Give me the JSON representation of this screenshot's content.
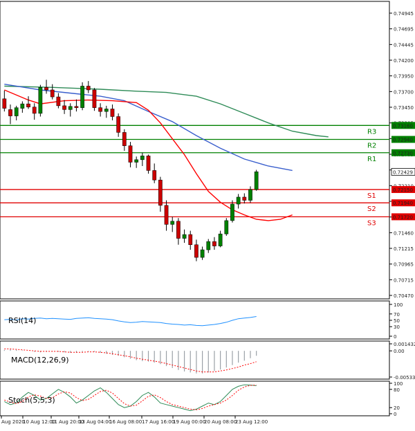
{
  "chart_data": [
    {
      "type": "candlestick",
      "panel": "price",
      "ylim": [
        0.7047,
        0.7505
      ],
      "y_ticks": [
        "0.74945",
        "0.74695",
        "0.74445",
        "0.74200",
        "0.73950",
        "0.73700",
        "0.73450",
        "0.73205",
        "0.72955",
        "0.72705",
        "0.72425",
        "0.72210",
        "0.71960",
        "0.71710",
        "0.71460",
        "0.71215",
        "0.70965",
        "0.70715",
        "0.70470"
      ],
      "x_ticks": [
        "Aug 2020",
        "10 Aug 12:00",
        "11 Aug 20:00",
        "13 Aug 04:00",
        "16 Aug 08:00",
        "17 Aug 16:00",
        "19 Aug 00:00",
        "20 Aug 08:00",
        "23 Aug 12:00"
      ],
      "last_price": {
        "value": 0.72429,
        "label": "0.72429",
        "color": "#000000"
      },
      "series": [
        {
          "kind": "sma",
          "color": "#2e8b57",
          "points": [
            [
              0,
              0.7378
            ],
            [
              8,
              0.7376
            ],
            [
              16,
              0.7373
            ],
            [
              22,
              0.737
            ],
            [
              27,
              0.7368
            ],
            [
              32,
              0.7362
            ],
            [
              36,
              0.735
            ],
            [
              40,
              0.7335
            ],
            [
              44,
              0.732
            ],
            [
              48,
              0.7307
            ],
            [
              52,
              0.73
            ],
            [
              54,
              0.7298
            ]
          ]
        },
        {
          "kind": "sma",
          "color": "#3a5fcd",
          "points": [
            [
              0,
              0.7381
            ],
            [
              6,
              0.7372
            ],
            [
              12,
              0.7366
            ],
            [
              16,
              0.7362
            ],
            [
              20,
              0.7355
            ],
            [
              24,
              0.7338
            ],
            [
              28,
              0.7322
            ],
            [
              32,
              0.73
            ],
            [
              36,
              0.728
            ],
            [
              40,
              0.7263
            ],
            [
              44,
              0.7252
            ],
            [
              48,
              0.7245
            ]
          ]
        },
        {
          "kind": "sma",
          "color": "#ff0000",
          "points": [
            [
              0,
              0.7372
            ],
            [
              4,
              0.7356
            ],
            [
              6,
              0.735
            ],
            [
              10,
              0.7355
            ],
            [
              14,
              0.7356
            ],
            [
              18,
              0.7355
            ],
            [
              22,
              0.7352
            ],
            [
              24,
              0.734
            ],
            [
              26,
              0.732
            ],
            [
              28,
              0.7295
            ],
            [
              30,
              0.727
            ],
            [
              32,
              0.724
            ],
            [
              34,
              0.7212
            ],
            [
              36,
              0.7195
            ],
            [
              38,
              0.7183
            ],
            [
              40,
              0.7175
            ],
            [
              42,
              0.7168
            ],
            [
              44,
              0.7166
            ],
            [
              46,
              0.7168
            ],
            [
              48,
              0.7175
            ]
          ]
        }
      ],
      "candles": [
        {
          "o": 0.7358,
          "h": 0.7371,
          "l": 0.7338,
          "c": 0.7343
        },
        {
          "o": 0.7341,
          "h": 0.7349,
          "l": 0.7318,
          "c": 0.7331
        },
        {
          "o": 0.7331,
          "h": 0.7347,
          "l": 0.7324,
          "c": 0.7344
        },
        {
          "o": 0.7343,
          "h": 0.7354,
          "l": 0.7336,
          "c": 0.735
        },
        {
          "o": 0.735,
          "h": 0.7362,
          "l": 0.7342,
          "c": 0.7345
        },
        {
          "o": 0.7345,
          "h": 0.7351,
          "l": 0.7325,
          "c": 0.7335
        },
        {
          "o": 0.7335,
          "h": 0.738,
          "l": 0.733,
          "c": 0.7376
        },
        {
          "o": 0.7376,
          "h": 0.7388,
          "l": 0.7366,
          "c": 0.7372
        },
        {
          "o": 0.7372,
          "h": 0.7381,
          "l": 0.7357,
          "c": 0.7361
        },
        {
          "o": 0.7361,
          "h": 0.7367,
          "l": 0.7343,
          "c": 0.7347
        },
        {
          "o": 0.7347,
          "h": 0.7356,
          "l": 0.7334,
          "c": 0.7341
        },
        {
          "o": 0.7341,
          "h": 0.7351,
          "l": 0.733,
          "c": 0.7346
        },
        {
          "o": 0.7346,
          "h": 0.7357,
          "l": 0.7338,
          "c": 0.7344
        },
        {
          "o": 0.7344,
          "h": 0.7384,
          "l": 0.734,
          "c": 0.7378
        },
        {
          "o": 0.7378,
          "h": 0.7386,
          "l": 0.7367,
          "c": 0.7372
        },
        {
          "o": 0.7372,
          "h": 0.7375,
          "l": 0.7339,
          "c": 0.7344
        },
        {
          "o": 0.7344,
          "h": 0.7351,
          "l": 0.733,
          "c": 0.7338
        },
        {
          "o": 0.7338,
          "h": 0.7347,
          "l": 0.7328,
          "c": 0.7342
        },
        {
          "o": 0.7342,
          "h": 0.7349,
          "l": 0.7324,
          "c": 0.733
        },
        {
          "o": 0.733,
          "h": 0.7335,
          "l": 0.7298,
          "c": 0.7305
        },
        {
          "o": 0.7305,
          "h": 0.731,
          "l": 0.7276,
          "c": 0.7284
        },
        {
          "o": 0.7284,
          "h": 0.729,
          "l": 0.725,
          "c": 0.7258
        },
        {
          "o": 0.7258,
          "h": 0.7267,
          "l": 0.7249,
          "c": 0.7262
        },
        {
          "o": 0.7262,
          "h": 0.7273,
          "l": 0.7252,
          "c": 0.7268
        },
        {
          "o": 0.7268,
          "h": 0.727,
          "l": 0.724,
          "c": 0.7245
        },
        {
          "o": 0.7245,
          "h": 0.7256,
          "l": 0.7225,
          "c": 0.723
        },
        {
          "o": 0.723,
          "h": 0.7235,
          "l": 0.718,
          "c": 0.719
        },
        {
          "o": 0.719,
          "h": 0.7198,
          "l": 0.715,
          "c": 0.716
        },
        {
          "o": 0.716,
          "h": 0.7172,
          "l": 0.7148,
          "c": 0.7165
        },
        {
          "o": 0.7165,
          "h": 0.717,
          "l": 0.7128,
          "c": 0.7138
        },
        {
          "o": 0.7138,
          "h": 0.7152,
          "l": 0.7131,
          "c": 0.7144
        },
        {
          "o": 0.7144,
          "h": 0.715,
          "l": 0.712,
          "c": 0.7128
        },
        {
          "o": 0.7128,
          "h": 0.7136,
          "l": 0.7102,
          "c": 0.7108
        },
        {
          "o": 0.7108,
          "h": 0.7125,
          "l": 0.7104,
          "c": 0.712
        },
        {
          "o": 0.712,
          "h": 0.7137,
          "l": 0.7115,
          "c": 0.7133
        },
        {
          "o": 0.7133,
          "h": 0.714,
          "l": 0.712,
          "c": 0.7126
        },
        {
          "o": 0.7126,
          "h": 0.715,
          "l": 0.7124,
          "c": 0.7145
        },
        {
          "o": 0.7145,
          "h": 0.717,
          "l": 0.7142,
          "c": 0.7166
        },
        {
          "o": 0.7166,
          "h": 0.7198,
          "l": 0.7163,
          "c": 0.7192
        },
        {
          "o": 0.7192,
          "h": 0.7208,
          "l": 0.7185,
          "c": 0.7203
        },
        {
          "o": 0.7203,
          "h": 0.7209,
          "l": 0.7193,
          "c": 0.7198
        },
        {
          "o": 0.7198,
          "h": 0.722,
          "l": 0.7194,
          "c": 0.7215
        },
        {
          "o": 0.7215,
          "h": 0.7246,
          "l": 0.7213,
          "c": 0.7243
        }
      ],
      "levels": [
        {
          "name": "R3",
          "value": 0.7316,
          "label": "0.73160",
          "color": "#008000"
        },
        {
          "name": "R2",
          "value": 0.7294,
          "label": "0.72940",
          "color": "#008000"
        },
        {
          "name": "R1",
          "value": 0.7273,
          "label": "0.72730",
          "color": "#008000"
        },
        {
          "name": "S1",
          "value": 0.7215,
          "label": "0.72150",
          "color": "#e00000"
        },
        {
          "name": "S2",
          "value": 0.7194,
          "label": "0.71940",
          "color": "#e00000"
        },
        {
          "name": "S3",
          "value": 0.7172,
          "label": "0.71720",
          "color": "#e00000"
        }
      ]
    },
    {
      "type": "line",
      "panel": "rsi",
      "label": "RSI(14)",
      "ylim": [
        0,
        100
      ],
      "y_ticks": [
        "100",
        "70",
        "50",
        "30",
        "0"
      ],
      "color": "#1e90ff",
      "values": [
        52,
        53,
        51,
        55,
        54,
        56,
        57,
        55,
        56,
        55,
        54,
        53,
        56,
        57,
        58,
        56,
        55,
        54,
        52,
        48,
        45,
        43,
        44,
        46,
        45,
        44,
        43,
        40,
        38,
        37,
        35,
        36,
        34,
        33,
        35,
        37,
        40,
        44,
        50,
        55,
        57,
        59,
        62
      ]
    },
    {
      "type": "histogram",
      "panel": "macd",
      "label": "MACD(12,26,9)",
      "y_ticks": [
        "0.001432",
        "0.00",
        "-0.005337"
      ],
      "ylim": [
        -0.005337,
        0.001432
      ],
      "hist_color": "#9aa0a6",
      "signal_color": "#ff0000",
      "hist": [
        0.0002,
        0.0003,
        0.0002,
        0.0001,
        0.0,
        -0.0002,
        -0.0003,
        -0.0002,
        -0.0001,
        -0.0002,
        -0.0003,
        -0.0004,
        -0.0004,
        -0.0002,
        -0.0001,
        -0.0002,
        -0.0004,
        -0.0006,
        -0.0008,
        -0.001,
        -0.0013,
        -0.0016,
        -0.0019,
        -0.0021,
        -0.0022,
        -0.0024,
        -0.0027,
        -0.0031,
        -0.0035,
        -0.0039,
        -0.0042,
        -0.0044,
        -0.0046,
        -0.0046,
        -0.0044,
        -0.0041,
        -0.0038,
        -0.0034,
        -0.0029,
        -0.0024,
        -0.002,
        -0.0015,
        -0.001
      ],
      "signal": [
        0.0004,
        0.0004,
        0.0003,
        0.0002,
        0.0001,
        0.0,
        -0.0001,
        -0.0001,
        -0.0001,
        -0.0001,
        -0.0002,
        -0.0003,
        -0.0003,
        -0.0003,
        -0.0002,
        -0.0002,
        -0.0003,
        -0.0004,
        -0.0006,
        -0.0008,
        -0.001,
        -0.0012,
        -0.0015,
        -0.0017,
        -0.0019,
        -0.0021,
        -0.0023,
        -0.0026,
        -0.0029,
        -0.0032,
        -0.0035,
        -0.0038,
        -0.0041,
        -0.0043,
        -0.0043,
        -0.0043,
        -0.0041,
        -0.0039,
        -0.0036,
        -0.0033,
        -0.0029,
        -0.0026,
        -0.0022
      ]
    },
    {
      "type": "line",
      "panel": "stoch",
      "label": "Stoch(5,5,3)",
      "ylim": [
        0,
        100
      ],
      "y_ticks": [
        "100",
        "80",
        "20",
        "0"
      ],
      "k_color": "#2e8b57",
      "d_color": "#ff0000",
      "k": [
        40,
        30,
        35,
        55,
        70,
        60,
        45,
        50,
        65,
        80,
        70,
        55,
        35,
        45,
        60,
        75,
        85,
        70,
        50,
        30,
        20,
        25,
        40,
        60,
        70,
        55,
        35,
        30,
        25,
        20,
        15,
        10,
        15,
        25,
        35,
        30,
        40,
        60,
        80,
        90,
        95,
        94,
        92
      ],
      "d": [
        45,
        38,
        33,
        40,
        55,
        62,
        58,
        50,
        52,
        65,
        72,
        68,
        53,
        43,
        47,
        60,
        73,
        77,
        68,
        50,
        33,
        25,
        28,
        42,
        57,
        62,
        53,
        40,
        30,
        25,
        20,
        15,
        13,
        17,
        25,
        30,
        35,
        45,
        60,
        77,
        88,
        93,
        94
      ]
    }
  ]
}
